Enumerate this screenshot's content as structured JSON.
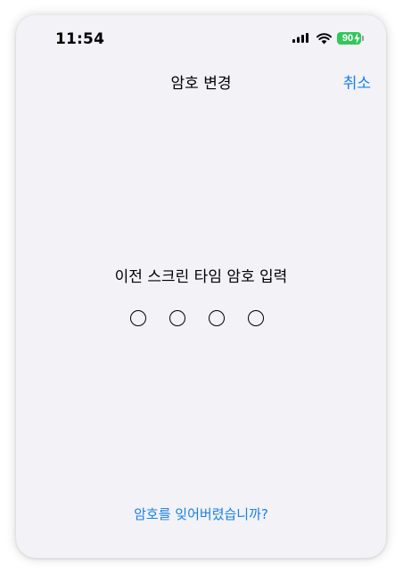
{
  "status_bar": {
    "time": "11:54",
    "battery_level": "90",
    "battery_color": "#33c759",
    "icons": [
      "signal-icon",
      "wifi-icon",
      "battery-icon",
      "charging-bolt-icon"
    ]
  },
  "nav": {
    "title": "암호 변경",
    "cancel_label": "취소"
  },
  "passcode": {
    "prompt": "이전 스크린 타임 암호 입력",
    "digits_total": 4,
    "digits_entered": 0
  },
  "footer": {
    "forgot_label": "암호를 잊어버렸습니까?"
  },
  "colors": {
    "accent": "#1a80e4",
    "background": "#f2f2f7"
  }
}
